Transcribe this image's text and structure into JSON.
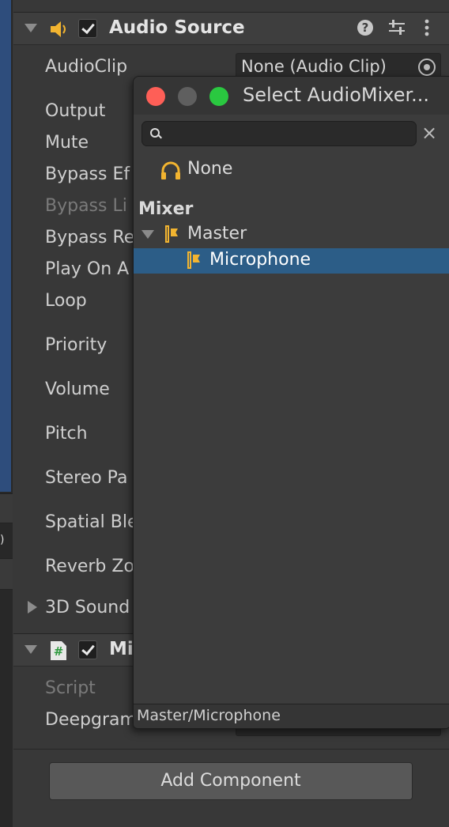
{
  "audio_source": {
    "title": "Audio Source",
    "props": {
      "audio_clip": "AudioClip",
      "output": "Output",
      "mute": "Mute",
      "bypass_effects": "Bypass Ef",
      "bypass_listener": "Bypass Li",
      "bypass_reverb": "Bypass Re",
      "play_on_awake": "Play On A",
      "loop": "Loop",
      "priority": "Priority",
      "volume": "Volume",
      "pitch": "Pitch",
      "stereo_pan": "Stereo Pa",
      "spatial_blend": "Spatial Ble",
      "reverb_zone": "Reverb Zo",
      "sound_3d": "3D Sound"
    },
    "audio_clip_value": "None (Audio Clip)"
  },
  "mic_component": {
    "title": "Mi",
    "script_label": "Script",
    "deepgram_label": "Deepgram"
  },
  "add_component": "Add Component",
  "popup": {
    "title": "Select AudioMixer...",
    "search_placeholder": "",
    "none_label": "None",
    "group_label": "Mixer",
    "master": "Master",
    "microphone": "Microphone",
    "status_path": "Master/Microphone"
  },
  "colors": {
    "selection": "#2c5d87",
    "close": "#fe5f57",
    "minimize": "#5f5f5f",
    "zoom": "#2ac840",
    "mixer_icon": "#f2b430"
  }
}
